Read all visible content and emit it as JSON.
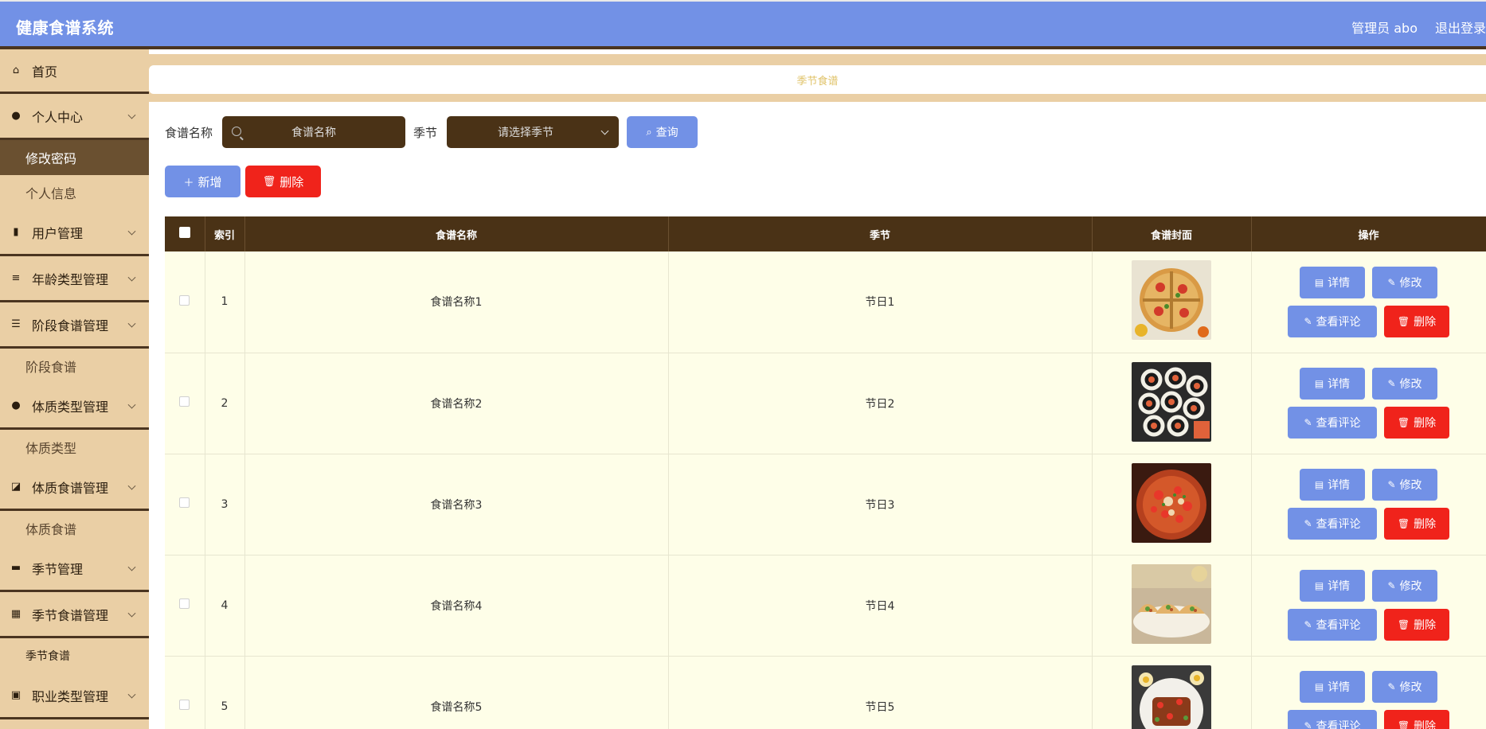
{
  "header": {
    "title": "健康食谱系统",
    "user": "管理员 abo",
    "logout": "退出登录"
  },
  "sidebar": {
    "items": [
      {
        "type": "menu",
        "label": "首页",
        "icon": "home-icon",
        "glyph": "⌂",
        "expand": false
      },
      {
        "type": "menu",
        "label": "个人中心",
        "icon": "user-icon",
        "glyph": "●",
        "expand": true
      },
      {
        "type": "sub",
        "label": "修改密码",
        "active": true
      },
      {
        "type": "sub",
        "label": "个人信息"
      },
      {
        "type": "menu",
        "label": "用户管理",
        "icon": "bar-chart-icon",
        "glyph": "▮",
        "expand": true
      },
      {
        "type": "menu",
        "label": "年龄类型管理",
        "icon": "list-icon",
        "glyph": "≡",
        "expand": true
      },
      {
        "type": "menu",
        "label": "阶段食谱管理",
        "icon": "sliders-icon",
        "glyph": "☰",
        "expand": true
      },
      {
        "type": "sub",
        "label": "阶段食谱"
      },
      {
        "type": "menu",
        "label": "体质类型管理",
        "icon": "lightbulb-icon",
        "glyph": "●",
        "expand": true
      },
      {
        "type": "sub",
        "label": "体质类型"
      },
      {
        "type": "menu",
        "label": "体质食谱管理",
        "icon": "chart-icon",
        "glyph": "◪",
        "expand": true
      },
      {
        "type": "sub",
        "label": "体质食谱"
      },
      {
        "type": "menu",
        "label": "季节管理",
        "icon": "briefcase-icon",
        "glyph": "▬",
        "expand": true
      },
      {
        "type": "menu",
        "label": "季节食谱管理",
        "icon": "grid-icon",
        "glyph": "▦",
        "expand": true
      },
      {
        "type": "sub",
        "label": "季节食谱",
        "small": true
      },
      {
        "type": "menu",
        "label": "职业类型管理",
        "icon": "clipboard-icon",
        "glyph": "▣",
        "expand": true
      }
    ]
  },
  "breadcrumb": {
    "label": "季节食谱"
  },
  "search": {
    "name_label": "食谱名称",
    "name_placeholder": "食谱名称",
    "season_label": "季节",
    "season_placeholder": "请选择季节",
    "query_label": "查询"
  },
  "actions": {
    "add_label": "新增",
    "delete_label": "删除"
  },
  "table": {
    "columns": [
      "",
      "索引",
      "食谱名称",
      "季节",
      "食谱封面",
      "操作"
    ],
    "rows": [
      {
        "index": "1",
        "name": "食谱名称1",
        "season": "节日1",
        "image": "pizza"
      },
      {
        "index": "2",
        "name": "食谱名称2",
        "season": "节日2",
        "image": "sushi"
      },
      {
        "index": "3",
        "name": "食谱名称3",
        "season": "节日3",
        "image": "stew"
      },
      {
        "index": "4",
        "name": "食谱名称4",
        "season": "节日4",
        "image": "tacos"
      },
      {
        "index": "5",
        "name": "食谱名称5",
        "season": "节日5",
        "image": "plate"
      }
    ],
    "ops": {
      "detail": "详情",
      "edit": "修改",
      "comments": "查看评论",
      "delete": "删除"
    }
  },
  "colors": {
    "header": "#7291e6",
    "sidebar": "#eacfa5",
    "dark_brown": "#4a3216",
    "accent_blue": "#7291e6",
    "danger_red": "#f0231b",
    "row_bg": "#fefee8"
  }
}
